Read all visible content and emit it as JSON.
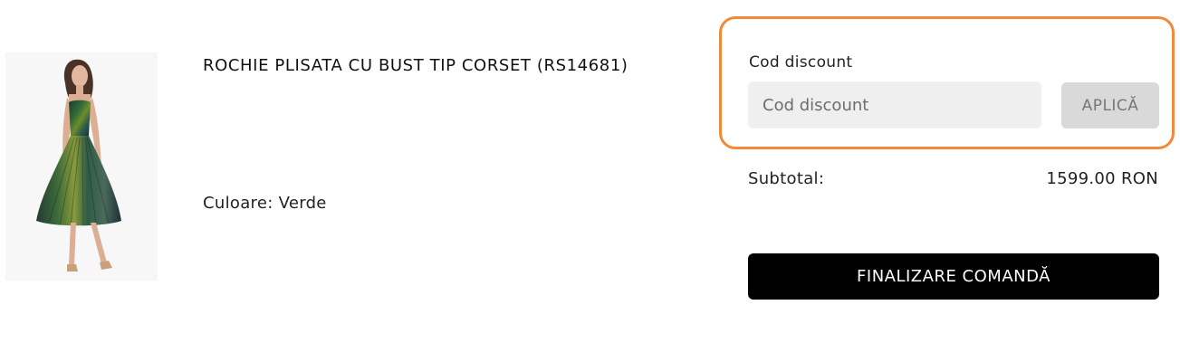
{
  "product": {
    "name": "ROCHIE PLISATA CU BUST TIP CORSET (RS14681)",
    "color_label": "Culoare:",
    "color_value": "Verde"
  },
  "discount": {
    "title": "Cod discount",
    "placeholder": "Cod discount",
    "value": "",
    "apply_label": "APLICĂ",
    "highlight_color": "#f08a3a"
  },
  "summary": {
    "subtotal_label": "Subtotal:",
    "subtotal_value": "1599.00 RON",
    "checkout_label": "FINALIZARE COMANDĂ"
  }
}
